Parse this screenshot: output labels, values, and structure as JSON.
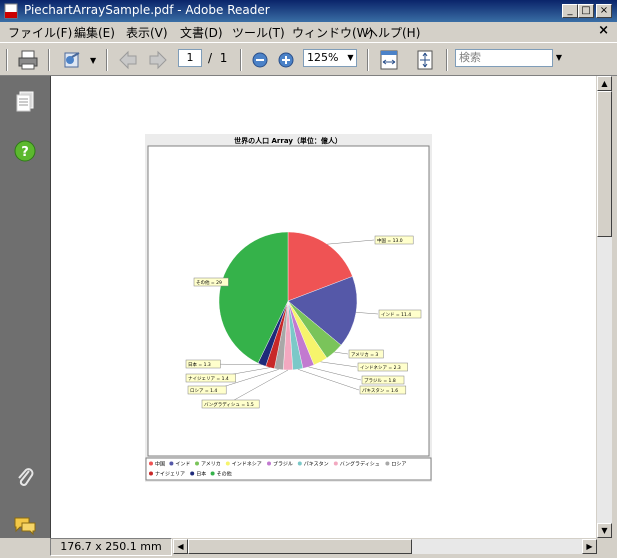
{
  "window": {
    "title": "PiechartArraySample.pdf - Adobe Reader"
  },
  "menu": [
    "ファイル(F)",
    "編集(E)",
    "表示(V)",
    "文書(D)",
    "ツール(T)",
    "ウィンドウ(W)",
    "ヘルプ(H)"
  ],
  "toolbar": {
    "page_current": "1",
    "page_sep": "/",
    "page_total": "1",
    "zoom": "125%",
    "search_placeholder": "検索"
  },
  "status": {
    "page_size": "176.7 x 250.1 mm"
  },
  "colors": {
    "title_bar": "#0a246a",
    "left_panel": "#6f6f6f"
  },
  "chart_data": {
    "type": "pie",
    "title": "世界の人口 Array（単位：億人）",
    "slices": [
      {
        "name": "中国",
        "value": 13.0,
        "label": "中国 = 13.0",
        "color": "#ef5354"
      },
      {
        "name": "インド",
        "value": 11.4,
        "label": "インド = 11.4",
        "color": "#5558a8"
      },
      {
        "name": "アメリカ",
        "value": 3,
        "label": "アメリカ = 3",
        "color": "#7ac45a"
      },
      {
        "name": "インドネシア",
        "value": 2.3,
        "label": "インドネシア = 2.3",
        "color": "#f6f46c"
      },
      {
        "name": "ブラジル",
        "value": 1.8,
        "label": "ブラジル = 1.8",
        "color": "#c27ad0"
      },
      {
        "name": "パキスタン",
        "value": 1.6,
        "label": "パキスタン = 1.6",
        "color": "#7bc8c8"
      },
      {
        "name": "バングラディシュ",
        "value": 1.5,
        "label": "バングラディシュ = 1.5",
        "color": "#f2a8c0"
      },
      {
        "name": "ロシア",
        "value": 1.4,
        "label": "ロシア = 1.4",
        "color": "#a8a8a8"
      },
      {
        "name": "ナイジェリア",
        "value": 1.4,
        "label": "ナイジェリア = 1.4",
        "color": "#c82828"
      },
      {
        "name": "日本",
        "value": 1.3,
        "label": "日本 = 1.3",
        "color": "#1e2a7a"
      },
      {
        "name": "その他",
        "value": 29,
        "label": "その他 = 29",
        "color": "#35b24a"
      }
    ],
    "legend_placement": "bottom"
  }
}
